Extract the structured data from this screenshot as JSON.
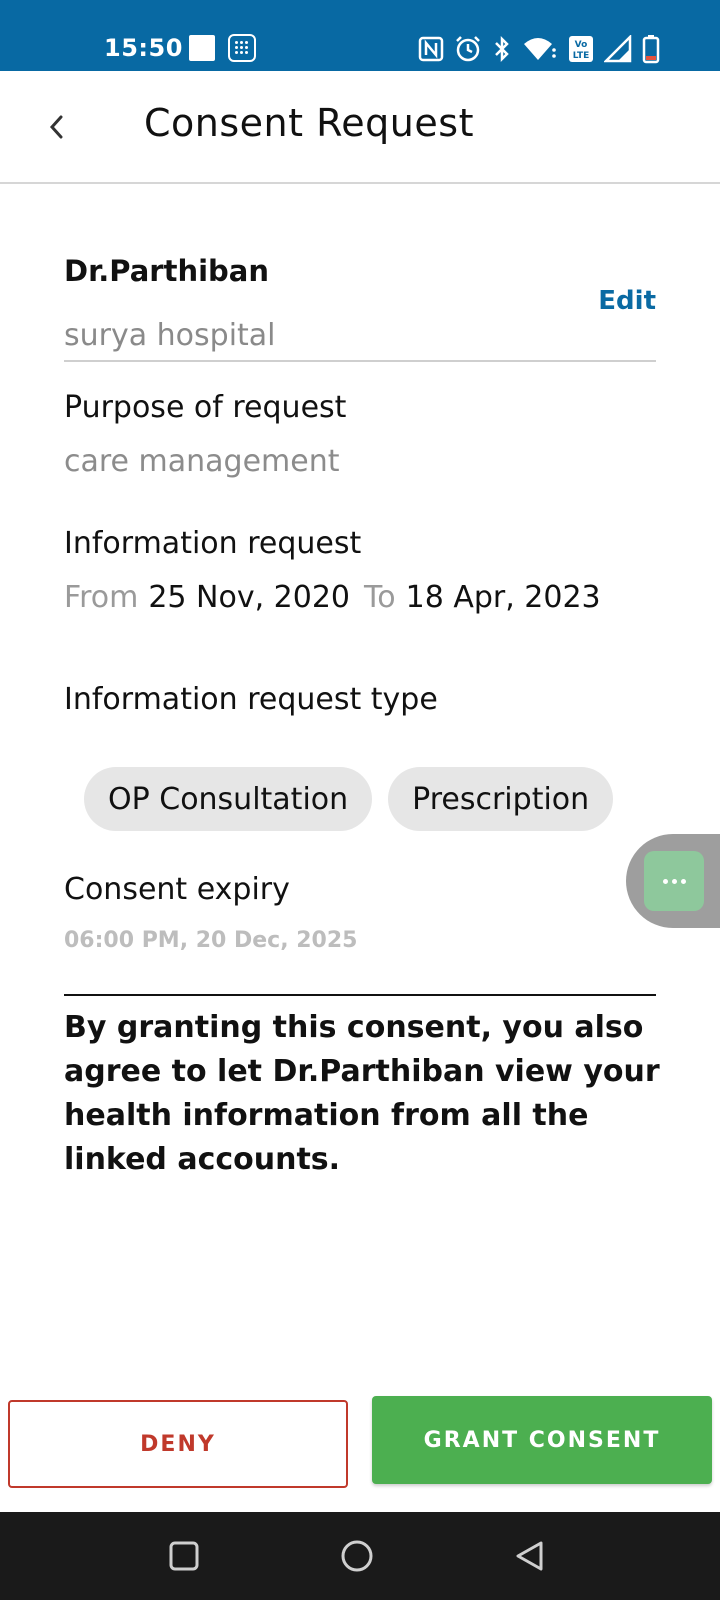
{
  "status_bar": {
    "time": "15:50",
    "icons": [
      "square-icon",
      "grid-app-icon",
      "nfc-icon",
      "alarm-icon",
      "bluetooth-icon",
      "wifi-icon",
      "volte-icon",
      "signal-icon",
      "battery-icon"
    ]
  },
  "app_bar": {
    "title": "Consent Request",
    "back_icon": "chevron-left-icon"
  },
  "requester": {
    "name": "Dr.Parthiban",
    "hospital": "surya hospital",
    "edit_label": "Edit"
  },
  "purpose": {
    "label": "Purpose of request",
    "value": "care management"
  },
  "information_request": {
    "label": "Information request",
    "from_label": "From",
    "from_date": "25 Nov, 2020",
    "to_label": "To",
    "to_date": "18 Apr, 2023"
  },
  "request_type": {
    "label": "Information request type",
    "chips": [
      "OP Consultation",
      "Prescription"
    ]
  },
  "expiry": {
    "label": "Consent expiry",
    "value": "06:00 PM, 20 Dec, 2025"
  },
  "notice": "By granting this consent, you also agree to let Dr.Parthiban view your health information from all the linked accounts.",
  "buttons": {
    "deny": "DENY",
    "grant": "GRANT CONSENT"
  },
  "colors": {
    "status_bar": "#0869a3",
    "accent_link": "#0a6aa3",
    "deny": "#c0392b",
    "grant": "#4caf50"
  },
  "nav": [
    "recent-apps-icon",
    "home-icon",
    "back-triangle-icon"
  ]
}
